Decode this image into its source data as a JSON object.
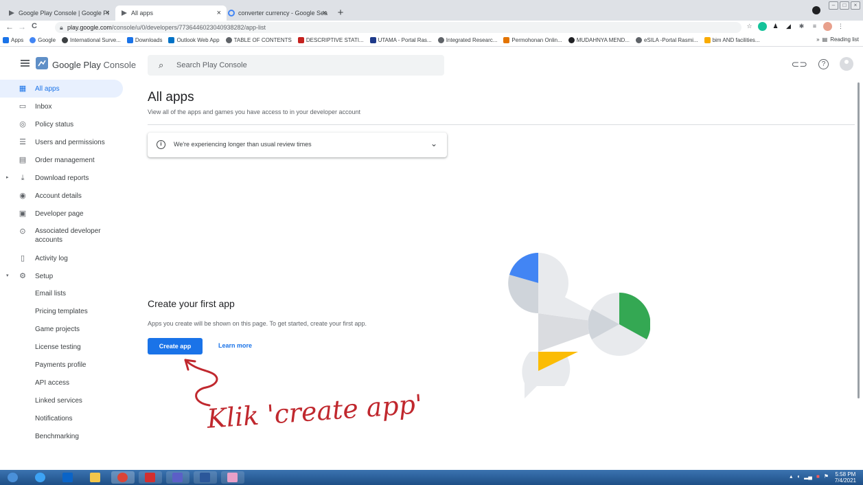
{
  "browser": {
    "tabs": [
      {
        "label": "Google Play Console | Google Pl",
        "active": false
      },
      {
        "label": "All apps",
        "active": true
      },
      {
        "label": "converter currency - Google Sea",
        "active": false
      }
    ],
    "tab_close": "×",
    "new_tab": "+",
    "nav": {
      "back": "←",
      "forward": "→",
      "reload": "C"
    },
    "url_host": "play.google.com",
    "url_path": "/console/u/0/developers/7736446023040938282/app-list",
    "bookmarks": [
      {
        "label": "Apps",
        "color": "#1a73e8"
      },
      {
        "label": "Google",
        "color": "#4285f4"
      },
      {
        "label": "International Surve...",
        "color": "#3c4043"
      },
      {
        "label": "Downloads",
        "color": "#1a73e8"
      },
      {
        "label": "Outlook Web App",
        "color": "#0072c6"
      },
      {
        "label": "TABLE OF CONTENTS",
        "color": "#5f6368"
      },
      {
        "label": "DESCRIPTIVE STATI...",
        "color": "#c5221f"
      },
      {
        "label": "UTAMA - Portal Ras...",
        "color": "#1e3a8a"
      },
      {
        "label": "Integrated Researc...",
        "color": "#5f6368"
      },
      {
        "label": "Permohonan Onlin...",
        "color": "#e37400"
      },
      {
        "label": "MUDAHNYA MEND...",
        "color": "#202124"
      },
      {
        "label": "eSILA -Portal Rasmi...",
        "color": "#5f6368"
      },
      {
        "label": "bim AND facilities...",
        "color": "#f9ab00"
      }
    ],
    "reading_list": "Reading list",
    "more": "»"
  },
  "header": {
    "brand_main": "Google Play",
    "brand_light": "Console",
    "search_placeholder": "Search Play Console"
  },
  "sidebar": {
    "items": [
      {
        "label": "All apps",
        "icon": "grid-icon",
        "glyph": "▦",
        "active": true
      },
      {
        "label": "Inbox",
        "icon": "inbox-icon",
        "glyph": "▭"
      },
      {
        "label": "Policy status",
        "icon": "shield-check-icon",
        "glyph": "◎"
      },
      {
        "label": "Users and permissions",
        "icon": "users-icon",
        "glyph": "☰"
      },
      {
        "label": "Order management",
        "icon": "credit-card-icon",
        "glyph": "▤"
      },
      {
        "label": "Download reports",
        "icon": "download-icon",
        "glyph": "⤓",
        "caret": "▸"
      },
      {
        "label": "Account details",
        "icon": "account-icon",
        "glyph": "◉"
      },
      {
        "label": "Developer page",
        "icon": "developer-page-icon",
        "glyph": "▣"
      },
      {
        "label": "Associated developer accounts",
        "icon": "associated-accounts-icon",
        "glyph": "⊙"
      },
      {
        "label": "Activity log",
        "icon": "activity-log-icon",
        "glyph": "▯"
      },
      {
        "label": "Setup",
        "icon": "gear-icon",
        "glyph": "⚙",
        "caret": "▾"
      }
    ],
    "setup_items": [
      "Email lists",
      "Pricing templates",
      "Game projects",
      "License testing",
      "Payments profile",
      "API access",
      "Linked services",
      "Notifications",
      "Benchmarking"
    ]
  },
  "main": {
    "title": "All apps",
    "subtitle": "View all of the apps and games you have access to in your developer account",
    "banner_text": "We're experiencing longer than usual review times",
    "first_title": "Create your first app",
    "first_desc": "Apps you create will be shown on this page. To get started, create your first app.",
    "create_button": "Create app",
    "learn_more": "Learn more"
  },
  "annotation": "Klik 'create app'",
  "taskbar": {
    "time": "5:58 PM",
    "date": "7/4/2021"
  },
  "colors": {
    "accent": "#1a73e8",
    "annotation": "#c0282e",
    "taskbar": "#2a5f9a"
  }
}
